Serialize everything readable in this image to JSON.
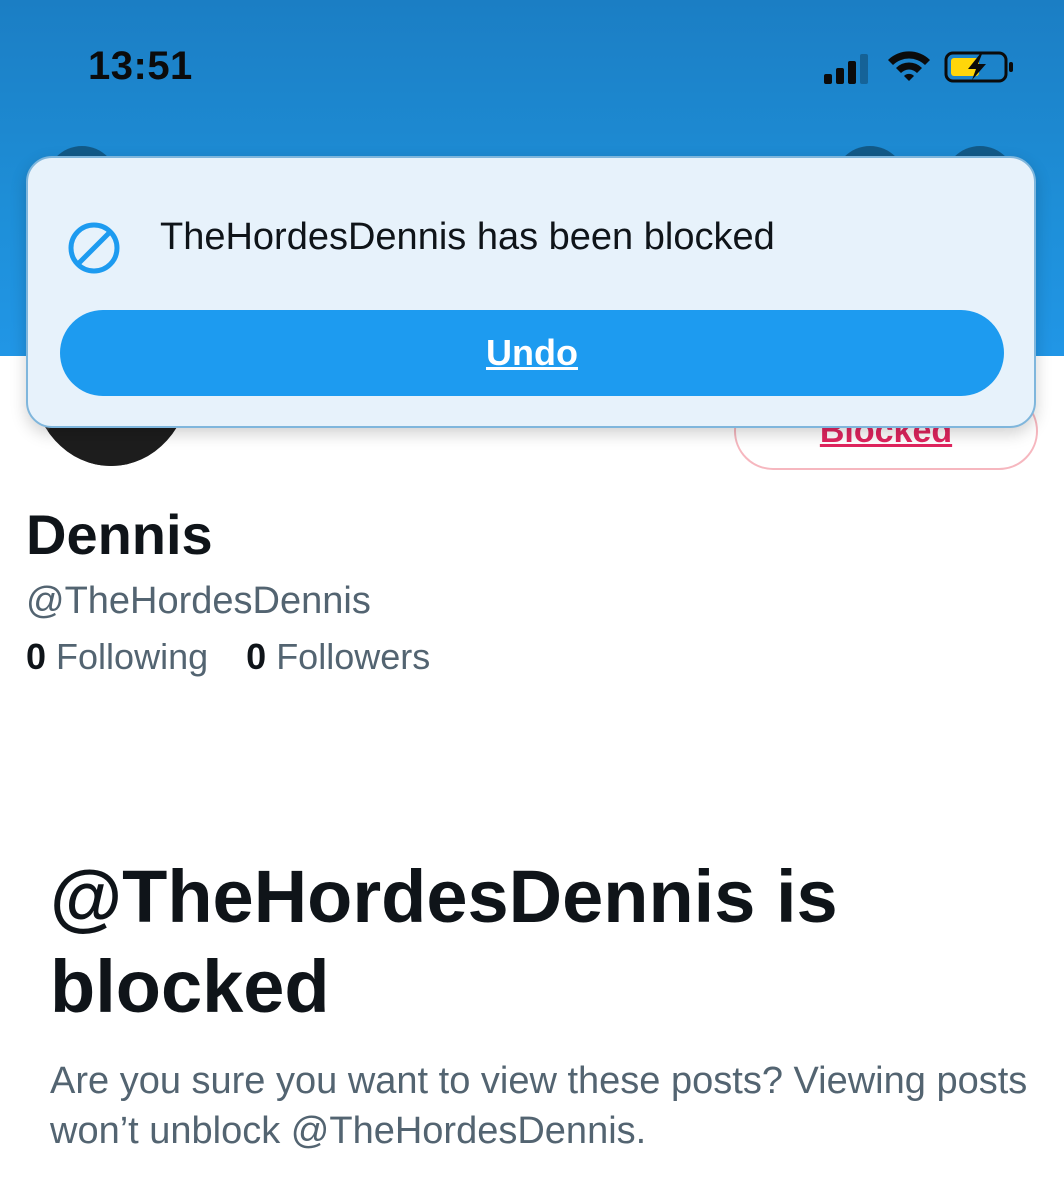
{
  "status_bar": {
    "time": "13:51",
    "icons": [
      "cellular-signal-icon",
      "wifi-icon",
      "battery-charging-icon"
    ]
  },
  "toast": {
    "icon": "block-icon",
    "message": "TheHordesDennis has been blocked",
    "undo_label": "Undo"
  },
  "profile": {
    "blocked_button_label": "Blocked",
    "display_name": "Dennis",
    "handle": "@TheHordesDennis",
    "following_count": "0",
    "following_label": "Following",
    "followers_count": "0",
    "followers_label": "Followers"
  },
  "blocked_notice": {
    "title": "@TheHordesDennis is blocked",
    "description": "Are you sure you want to view these posts? Viewing posts won’t unblock @TheHordesDennis."
  },
  "colors": {
    "banner": "#1e8fd8",
    "accent": "#1d9bf0",
    "toast_background": "#e7f2fb",
    "blocked_red": "#e0245e",
    "secondary_text": "#536471"
  }
}
